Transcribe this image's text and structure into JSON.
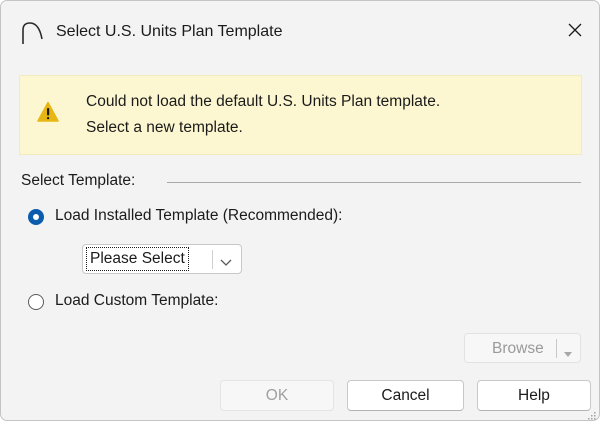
{
  "window": {
    "title": "Select U.S. Units Plan Template",
    "icon": "app-arc-icon",
    "close_icon": "close-icon"
  },
  "warning": {
    "icon": "warning-triangle-icon",
    "color": "#e8b612",
    "background": "#fcf7d0",
    "line1": "Could not load the default U.S. Units Plan template.",
    "line2": "Select a new template."
  },
  "template_group": {
    "label": "Select Template:",
    "options": [
      {
        "label": "Load Installed Template (Recommended):",
        "selected": true
      },
      {
        "label": "Load Custom Template:",
        "selected": false
      }
    ],
    "installed_combo": {
      "value": "Please Select",
      "arrow_icon": "chevron-down-icon"
    },
    "browse": {
      "label": "Browse",
      "enabled": false,
      "arrow_icon": "caret-down-icon"
    }
  },
  "buttons": {
    "ok": {
      "label": "OK",
      "enabled": false
    },
    "cancel": {
      "label": "Cancel",
      "enabled": true
    },
    "help": {
      "label": "Help",
      "enabled": true
    }
  },
  "colors": {
    "accent": "#0b5cad",
    "window_bg": "#f3f3f3",
    "disabled_text": "#9a9a9a"
  }
}
